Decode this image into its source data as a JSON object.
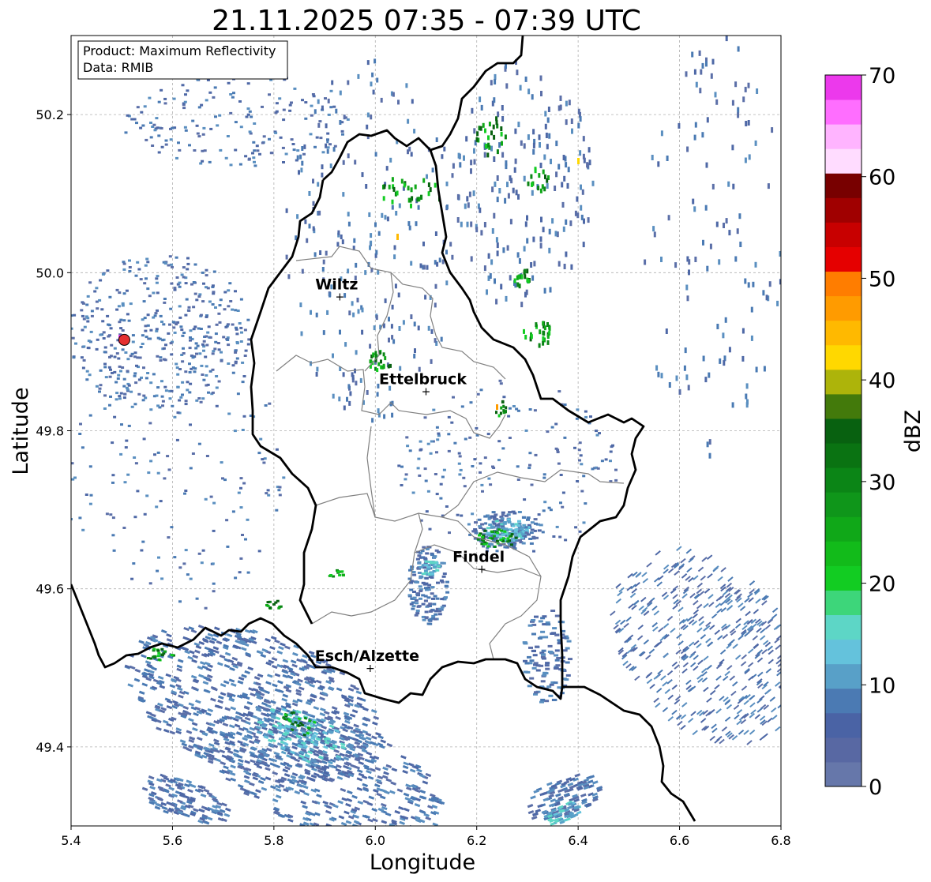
{
  "title": "21.11.2025 07:35 - 07:39 UTC",
  "info_box": {
    "product_line": "Product: Maximum Reflectivity",
    "data_line": "Data: RMIB"
  },
  "chart_data": {
    "type": "heatmap",
    "title": "21.11.2025 07:35 - 07:39 UTC",
    "xlabel": "Longitude",
    "ylabel": "Latitude",
    "xlim": [
      5.4,
      6.8
    ],
    "ylim": [
      49.3,
      50.3
    ],
    "x_ticks": [
      5.4,
      5.6,
      5.8,
      6.0,
      6.2,
      6.4,
      6.6,
      6.8
    ],
    "x_tick_labels": [
      "5.4",
      "5.6",
      "5.8",
      "6.0",
      "6.2",
      "6.4",
      "6.6",
      "6.8"
    ],
    "y_ticks": [
      49.4,
      49.6,
      49.8,
      50.0,
      50.2
    ],
    "y_tick_labels": [
      "49.4",
      "49.6",
      "49.8",
      "50.0",
      "50.2"
    ],
    "grid": true,
    "colorbar": {
      "label": "dBZ",
      "min": 0,
      "max": 70,
      "ticks": [
        0,
        10,
        20,
        30,
        40,
        50,
        60,
        70
      ],
      "tick_labels": [
        "0",
        "10",
        "20",
        "30",
        "40",
        "50",
        "60",
        "70"
      ],
      "colors": [
        "#6677aa",
        "#5868a3",
        "#4a63a5",
        "#4b7ab3",
        "#58a0c8",
        "#64c2dc",
        "#5dd6c6",
        "#3dd67a",
        "#12cc22",
        "#12bb1a",
        "#10a818",
        "#0f961a",
        "#0b8516",
        "#0a7312",
        "#086110",
        "#437a0b",
        "#adb40a",
        "#ffd800",
        "#ffb900",
        "#ff9b00",
        "#ff7d00",
        "#e50000",
        "#c80000",
        "#a00000",
        "#780000",
        "#ffdcff",
        "#ffb4ff",
        "#ff6eff",
        "#ec39ec"
      ]
    },
    "places": [
      {
        "name": "Wiltz",
        "lon": 5.93,
        "lat": 49.97
      },
      {
        "name": "Ettelbruck",
        "lon": 6.1,
        "lat": 49.85
      },
      {
        "name": "Findel",
        "lon": 6.21,
        "lat": 49.625
      },
      {
        "name": "Esch/Alzette",
        "lon": 5.99,
        "lat": 49.5
      }
    ],
    "radar_site": {
      "lon": 5.505,
      "lat": 49.915
    }
  }
}
